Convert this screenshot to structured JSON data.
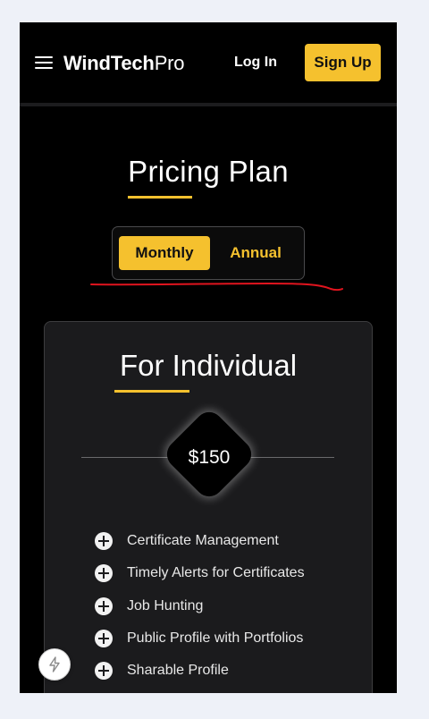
{
  "header": {
    "brand_bold": "WindTech",
    "brand_light": "Pro",
    "login_label": "Log In",
    "signup_label": "Sign Up"
  },
  "page": {
    "title": "Pricing Plan"
  },
  "billing_toggle": {
    "options": [
      "Monthly",
      "Annual"
    ],
    "selected": "Monthly"
  },
  "plan_card": {
    "title": "For Individual",
    "price": "$150",
    "features": [
      "Certificate Management",
      "Timely Alerts for Certificates",
      "Job Hunting",
      "Public Profile with Portfolios",
      "Sharable Profile"
    ]
  },
  "icons": {
    "menu": "hamburger-icon",
    "feature_bullet": "plus-circle-icon",
    "floating": "lightning-bolt-icon"
  },
  "colors": {
    "accent": "#f5c12e",
    "background": "#000000",
    "card": "#1b1b1d",
    "annotation": "#e0141e"
  }
}
